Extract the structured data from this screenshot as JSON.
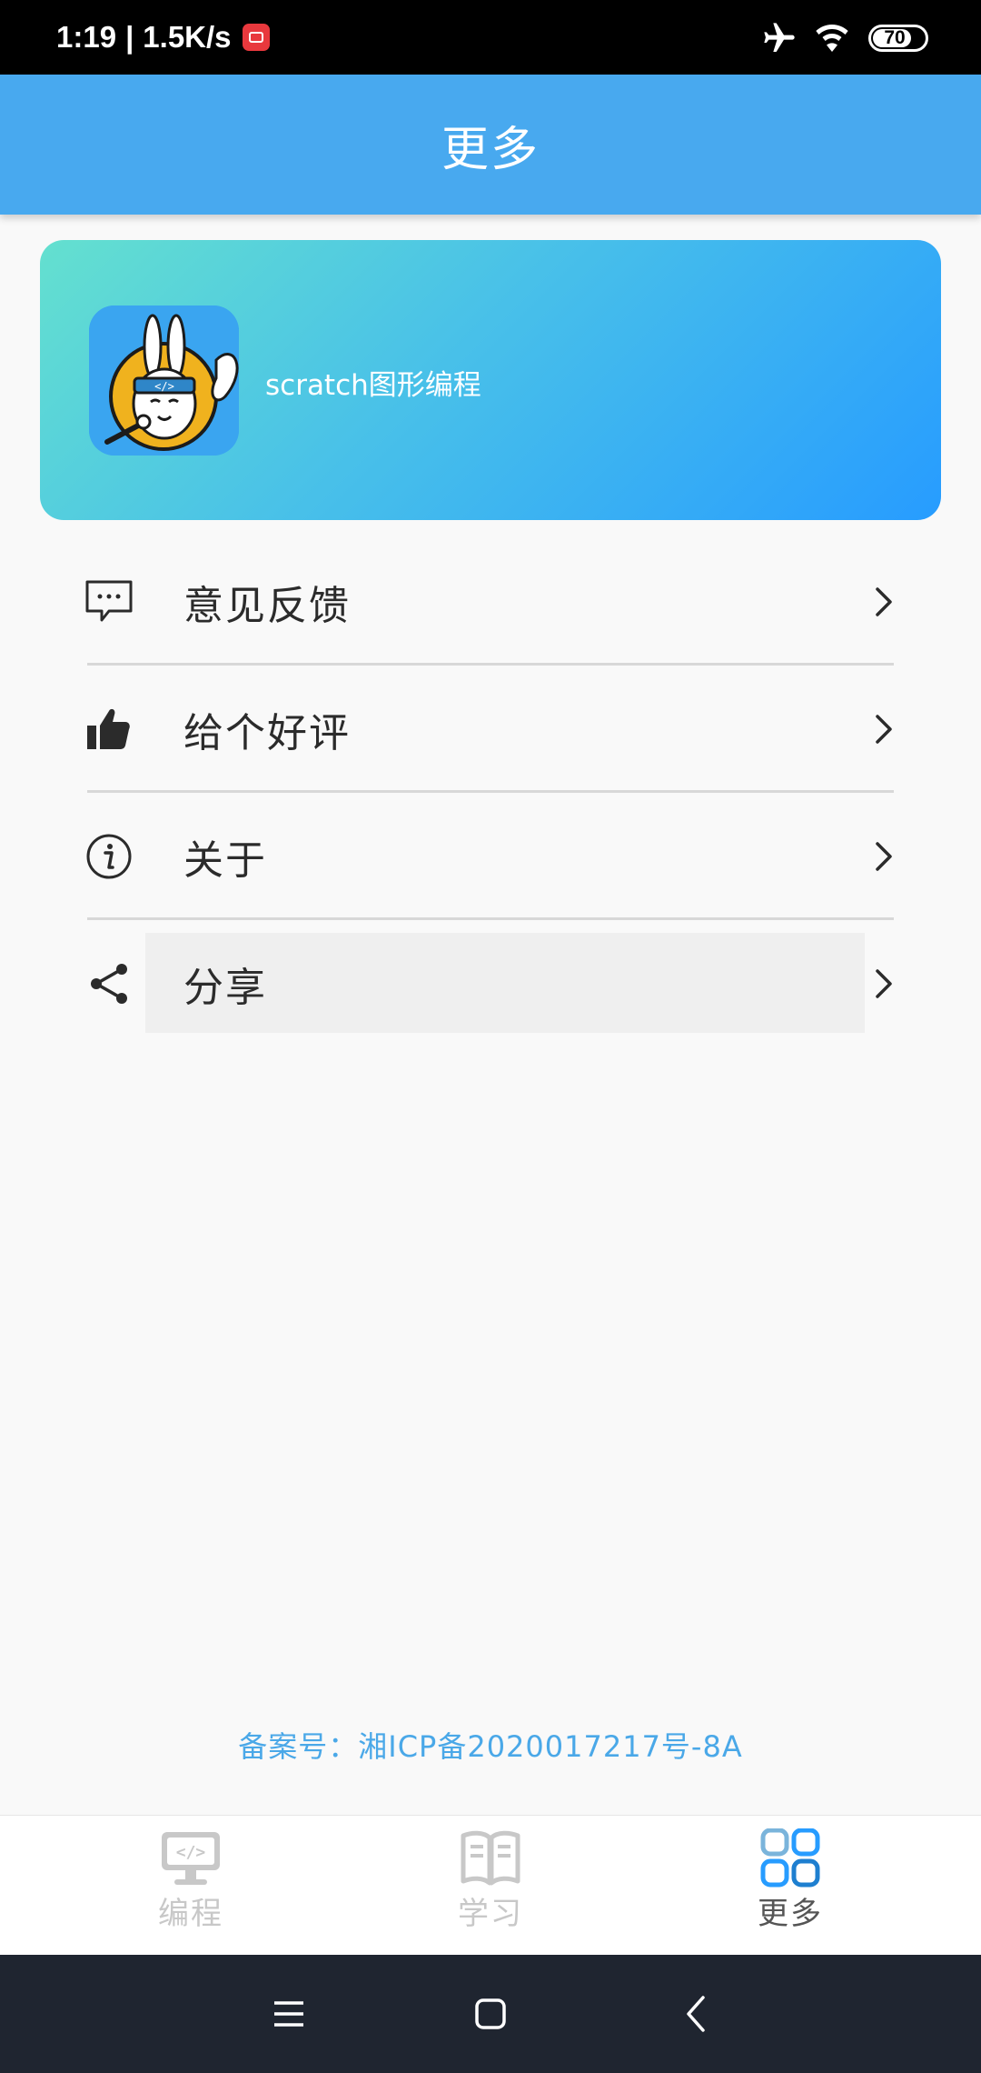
{
  "status_bar": {
    "time": "1:19",
    "separator": "|",
    "speed": "1.5K/s",
    "battery": "70"
  },
  "header": {
    "title": "更多"
  },
  "banner": {
    "app_name": "scratch图形编程"
  },
  "menu": {
    "items": [
      {
        "label": "意见反馈",
        "icon": "feedback-icon"
      },
      {
        "label": "给个好评",
        "icon": "thumbs-up-icon"
      },
      {
        "label": "关于",
        "icon": "info-icon"
      },
      {
        "label": "分享",
        "icon": "share-icon"
      }
    ]
  },
  "footer": {
    "icp": "备案号：湘ICP备2020017217号-8A"
  },
  "bottom_nav": {
    "items": [
      {
        "label": "编程",
        "icon": "code-monitor-icon",
        "active": false
      },
      {
        "label": "学习",
        "icon": "book-icon",
        "active": false
      },
      {
        "label": "更多",
        "icon": "grid-icon",
        "active": true
      }
    ]
  },
  "colors": {
    "header_bg": "#48a9ef",
    "accent": "#279cff",
    "inactive": "#c8c8c8",
    "icp_text": "#4aa8e8"
  }
}
